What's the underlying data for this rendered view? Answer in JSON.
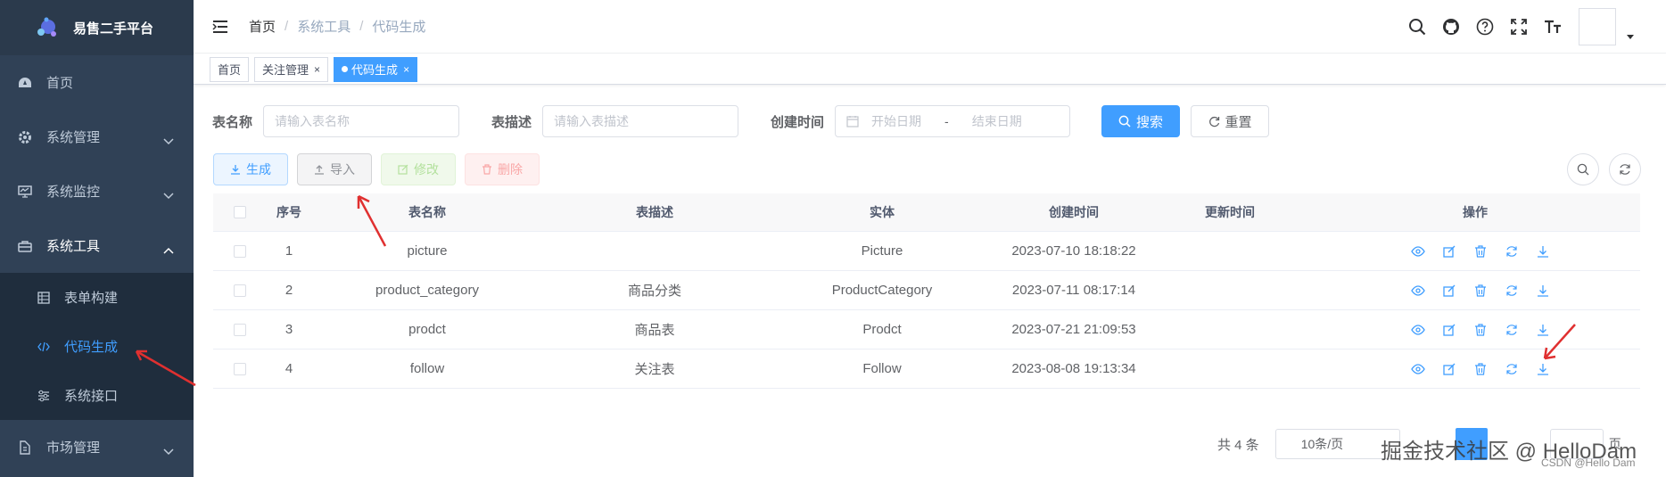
{
  "app": {
    "title": "易售二手平台"
  },
  "sidebar": {
    "items": [
      {
        "label": "首页",
        "icon": "dashboard-icon"
      },
      {
        "label": "系统管理",
        "icon": "gear-icon"
      },
      {
        "label": "系统监控",
        "icon": "monitor-icon"
      },
      {
        "label": "系统工具",
        "icon": "toolbox-icon",
        "expanded": true,
        "children": [
          {
            "label": "表单构建",
            "icon": "table-icon"
          },
          {
            "label": "代码生成",
            "icon": "code-icon",
            "active": true
          },
          {
            "label": "系统接口",
            "icon": "sliders-icon"
          }
        ]
      },
      {
        "label": "市场管理",
        "icon": "market-icon"
      }
    ]
  },
  "header": {
    "breadcrumb": [
      "首页",
      "系统工具",
      "代码生成"
    ],
    "separator": "/"
  },
  "tags": [
    {
      "label": "首页",
      "closable": false,
      "active": false
    },
    {
      "label": "关注管理",
      "closable": true,
      "active": false
    },
    {
      "label": "代码生成",
      "closable": true,
      "active": true
    }
  ],
  "search": {
    "table_name_label": "表名称",
    "table_name_placeholder": "请输入表名称",
    "table_desc_label": "表描述",
    "table_desc_placeholder": "请输入表描述",
    "created_label": "创建时间",
    "start_placeholder": "开始日期",
    "range_sep": "-",
    "end_placeholder": "结束日期",
    "search_button": "搜索",
    "reset_button": "重置"
  },
  "toolbar": {
    "generate": "生成",
    "import": "导入",
    "edit": "修改",
    "delete": "删除"
  },
  "table": {
    "headers": [
      "序号",
      "表名称",
      "表描述",
      "实体",
      "创建时间",
      "更新时间",
      "操作"
    ],
    "rows": [
      {
        "index": "1",
        "name": "picture",
        "desc": "",
        "entity": "Picture",
        "created": "2023-07-10 18:18:22",
        "updated": ""
      },
      {
        "index": "2",
        "name": "product_category",
        "desc": "商品分类",
        "entity": "ProductCategory",
        "created": "2023-07-11 08:17:14",
        "updated": ""
      },
      {
        "index": "3",
        "name": "prodct",
        "desc": "商品表",
        "entity": "Prodct",
        "created": "2023-07-21 21:09:53",
        "updated": ""
      },
      {
        "index": "4",
        "name": "follow",
        "desc": "关注表",
        "entity": "Follow",
        "created": "2023-08-08 19:13:34",
        "updated": ""
      }
    ]
  },
  "pagination": {
    "total": "共 4 条",
    "page_size": "10条/页",
    "suffix": "页"
  },
  "watermark": {
    "main": "掘金技术社区 @ HelloDam",
    "sub": "CSDN @Hello Dam"
  },
  "colors": {
    "primary": "#409eff",
    "sidebar": "#304156",
    "sidebar_sub": "#1f2d3d",
    "annotation": "#e03030"
  }
}
